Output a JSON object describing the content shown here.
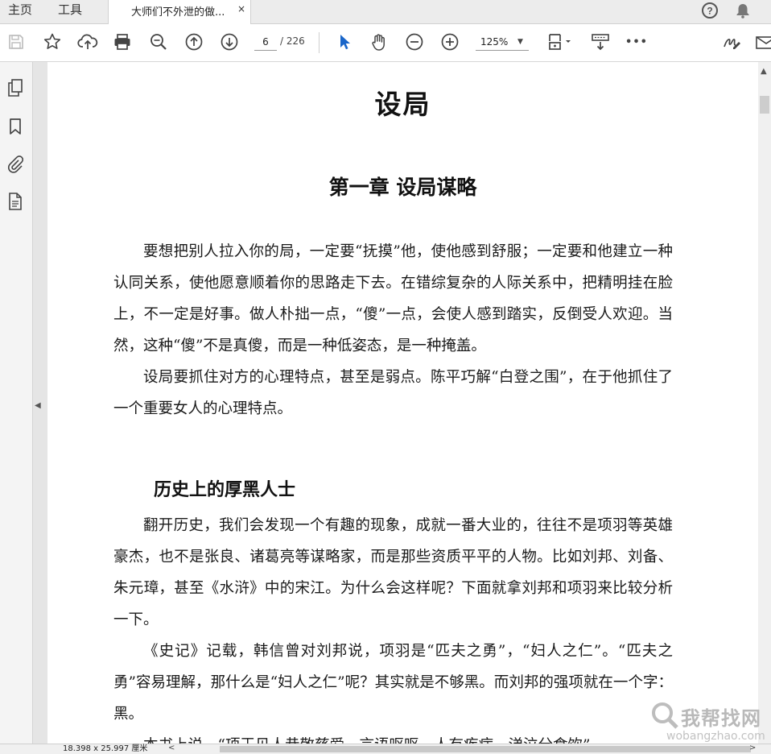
{
  "tabs": {
    "home_label": "主页",
    "tools_label": "工具",
    "document_tab_title": "大师们不外泄的做...",
    "close_glyph": "×"
  },
  "toolbar": {
    "current_page": "6",
    "total_pages": "/ 226",
    "zoom": "125%",
    "zoom_arrow": "▼",
    "more_glyph": "•••",
    "icons": [
      "save-icon",
      "bookmark-star-icon",
      "cloud-upload-icon",
      "print-icon",
      "zoom-out-search-icon",
      "page-up-icon",
      "page-down-icon",
      "select-cursor-icon",
      "hand-tool-icon",
      "zoom-out-icon",
      "zoom-in-icon",
      "fit-page-icon",
      "scroll-mode-icon",
      "more-icon",
      "sign-icon",
      "mail-icon"
    ]
  },
  "header_right": {
    "icons": [
      "help-icon",
      "notification-bell-icon"
    ]
  },
  "left_panel": {
    "icons": [
      "page-thumbnails-icon",
      "bookmarks-icon",
      "attachments-icon",
      "document-properties-icon"
    ],
    "collapse_glyph": "◀"
  },
  "document": {
    "title": "设局",
    "chapter": "第一章  设局谋略",
    "section": "历史上的厚黑人士",
    "paragraphs": [
      "要想把别人拉入你的局，一定要“抚摸”他，使他感到舒服；一定要和他建立一种认同关系，使他愿意顺着你的思路走下去。在错综复杂的人际关系中，把精明挂在脸上，不一定是好事。做人朴拙一点，“傻”一点，会使人感到踏实，反倒受人欢迎。当然，这种“傻”不是真傻，而是一种低姿态，是一种掩盖。",
      "设局要抓住对方的心理特点，甚至是弱点。陈平巧解“白登之围”，在于他抓住了一个重要女人的心理特点。",
      "翻开历史，我们会发现一个有趣的现象，成就一番大业的，往往不是项羽等英雄豪杰，也不是张良、诸葛亮等谋略家，而是那些资质平平的人物。比如刘邦、刘备、朱元璋，甚至《水浒》中的宋江。为什么会这样呢？下面就拿刘邦和项羽来比较分析一下。",
      "《史记》记载，韩信曾对刘邦说，项羽是“匹夫之勇”，“妇人之仁”。“匹夫之勇”容易理解，那什么是“妇人之仁”呢？其实就是不够黑。而刘邦的强项就在一个字：黑。",
      "本书上说，“项王见人恭敬慈爱，言语呕呕，人有疾病，涕泣分食饮”"
    ]
  },
  "status": {
    "page_dimensions": "18.398 x 25.997 厘米",
    "hscroll_left": "<",
    "hscroll_right": ">"
  },
  "scrollbar": {
    "up_glyph": "▲"
  },
  "watermark": {
    "cn": "我帮找网",
    "en": "wobangzhao.com"
  }
}
